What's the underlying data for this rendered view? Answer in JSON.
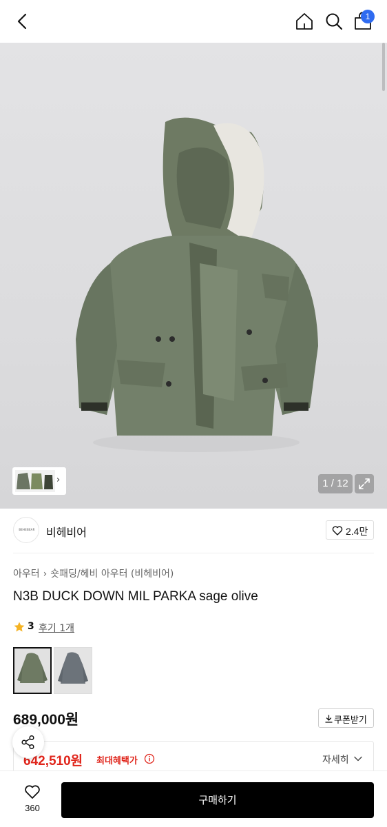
{
  "header": {
    "back_icon": "chevron-left-icon",
    "home_icon": "home-icon",
    "search_icon": "search-icon",
    "cart_icon": "shopping-bag-icon",
    "cart_badge": "1"
  },
  "gallery": {
    "counter": "1 / 12",
    "expand_icon": "expand-icon",
    "thumbnail_more_icon": "chevron-right-icon"
  },
  "brand": {
    "logo_text": "BEHEBEAR",
    "name": "비헤비어",
    "like_count": "2.4만"
  },
  "breadcrumb": {
    "items": [
      "아우터",
      "숏패딩/헤비 아우터 (비헤비어)"
    ]
  },
  "product": {
    "title": "N3B DUCK DOWN MIL PARKA sage olive",
    "rating": "3",
    "review_text": "후기 1개",
    "price": "689,000원",
    "coupon_label": "쿠폰받기"
  },
  "benefit": {
    "price": "642,510원",
    "label": "최대혜택가",
    "detail": "자세히"
  },
  "bottom": {
    "wish_count": "360",
    "buy_label": "구매하기"
  },
  "colors": {
    "accent_red": "#e0251b",
    "badge_blue": "#2f6bf0",
    "buy_button": "#000000"
  }
}
